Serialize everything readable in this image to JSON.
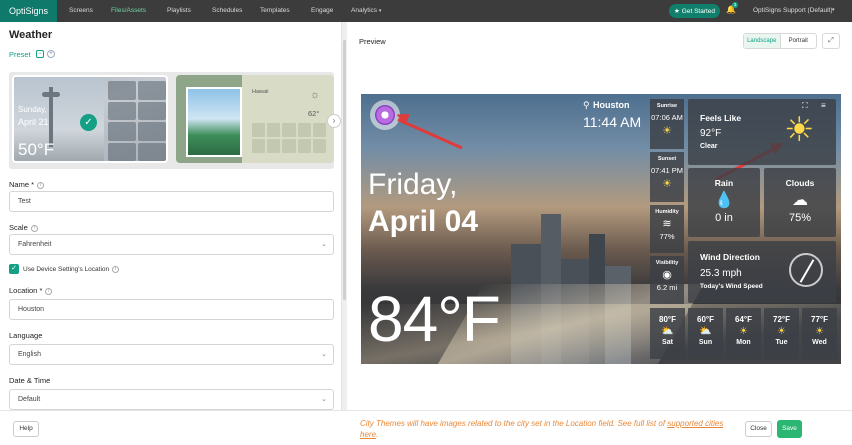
{
  "topnav": {
    "logo": "OptiSigns",
    "items": [
      "Screens",
      "Files/Assets",
      "Playlists",
      "Schedules",
      "Templates",
      "Engage",
      "Analytics"
    ],
    "analytics_caret": "▾",
    "get_started": "Get Started",
    "bell_count": "3",
    "account": "OptiSigns Support (Default)",
    "account_caret": "▾"
  },
  "editor": {
    "title": "Weather",
    "preset_label": "Preset",
    "preset_toggle": "−",
    "preset_add": "+",
    "preset_thumbnails": [
      {
        "day": "Sunday,",
        "date": "April 21",
        "temp": "50°F"
      },
      {
        "city": "Hawaii",
        "temp": "62°"
      }
    ],
    "carousel_next": "›",
    "name_label": "Name *",
    "name_value": "Test",
    "scale_label": "Scale",
    "scale_value": "Fahrenheit",
    "device_location_label": "Use Device Setting's Location",
    "device_location_checked": true,
    "location_label": "Location *",
    "location_value": "Houston",
    "language_label": "Language",
    "language_value": "English",
    "datetime_label": "Date & Time",
    "datetime_value": "Default"
  },
  "preview": {
    "label": "Preview",
    "orientation_options": [
      "Landscape",
      "Portrait"
    ],
    "orientation_selected": "Landscape",
    "weather": {
      "city": "Houston",
      "time": "11:44 AM",
      "day": "Friday,",
      "date": "April 04",
      "temp": "84°F",
      "sunrise_label": "Sunrise",
      "sunrise": "07:06 AM",
      "sunset_label": "Sunset",
      "sunset": "07:41 PM",
      "humidity_label": "Humidity",
      "humidity": "77%",
      "visibility_label": "Visibility",
      "visibility": "6.2 mi",
      "feels_like_label": "Feels Like",
      "feels_like": "92°F",
      "feels_like_desc": "Clear",
      "rain_label": "Rain",
      "rain": "0 in",
      "clouds_label": "Clouds",
      "clouds": "75%",
      "wind_label": "Wind Direction",
      "wind_speed": "25.3 mph",
      "wind_desc": "Today's Wind Speed",
      "forecast": [
        {
          "temp": "80°F",
          "day": "Sat"
        },
        {
          "temp": "60°F",
          "day": "Sun"
        },
        {
          "temp": "64°F",
          "day": "Mon"
        },
        {
          "temp": "72°F",
          "day": "Tue"
        },
        {
          "temp": "77°F",
          "day": "Wed"
        }
      ]
    }
  },
  "footer": {
    "help": "Help",
    "note": "City Themes will have images related to the city set in the Location field. See full list of",
    "note_link": "supported cities here",
    "note_end": ".",
    "close": "Close",
    "save": "Save"
  },
  "colors": {
    "accent": "#13a085",
    "note": "#e8893a",
    "arrow": "#e03a3a",
    "nav": "#3c3c3c"
  }
}
